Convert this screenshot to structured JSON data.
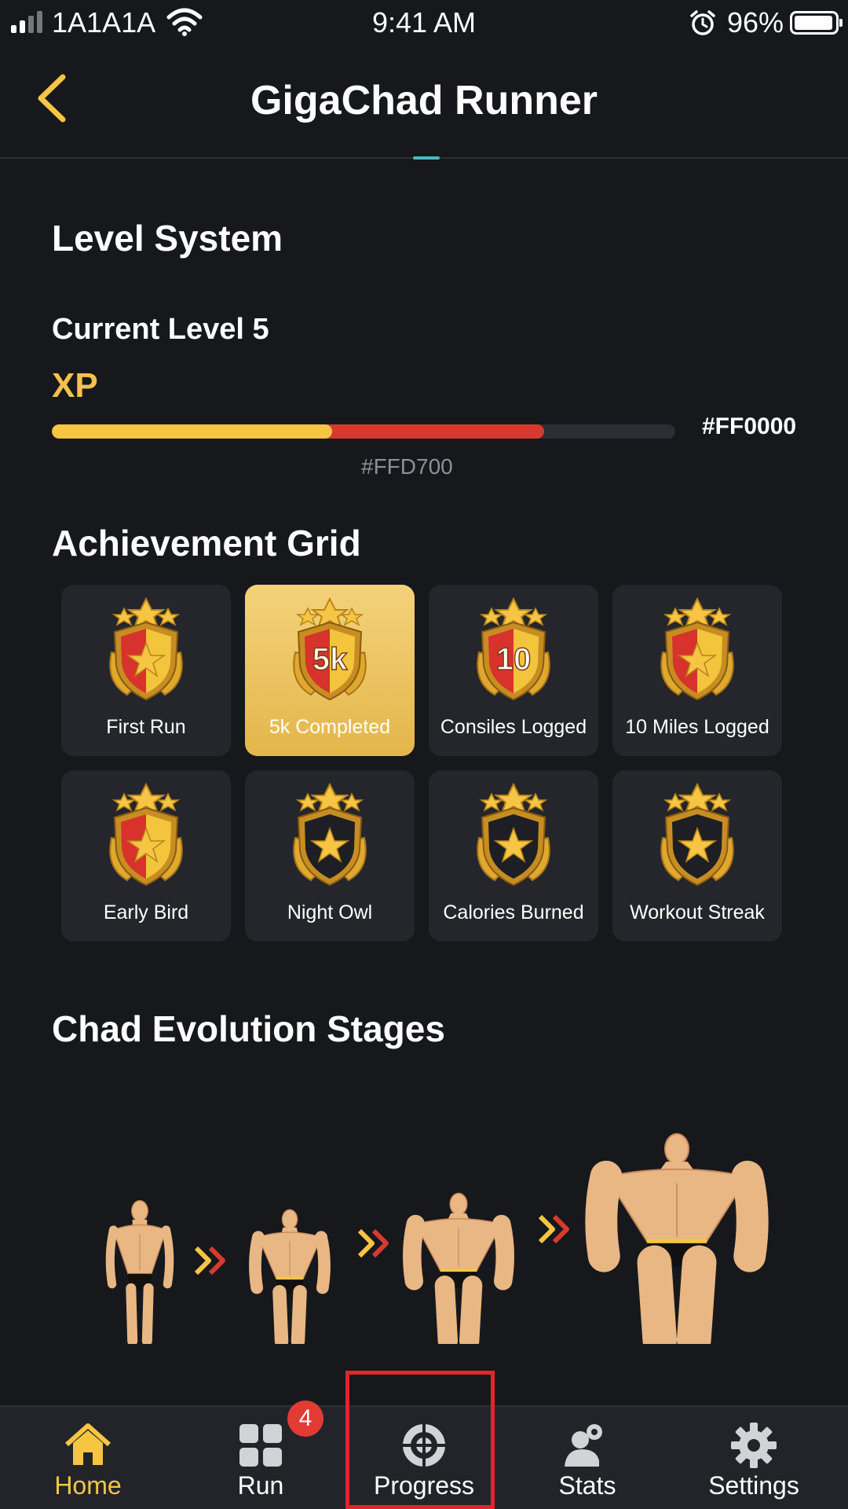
{
  "status_bar": {
    "carrier": "1A1A1A",
    "time": "9:41 AM",
    "battery": "96%",
    "battery_level": 0.96,
    "icons": [
      "signal-icon",
      "wifi-icon",
      "alarm-icon",
      "battery-icon"
    ]
  },
  "header": {
    "title": "GigaChad Runner",
    "back_icon": "chevron-left-icon"
  },
  "level_system": {
    "section_title": "Level System",
    "current_level": "Current Level 5",
    "xp_label": "XP",
    "xp_progress_gold": 0.45,
    "xp_progress_red": 0.79,
    "red_hex": "#FF0000",
    "gold_hex": "#FFD700"
  },
  "achievements": {
    "section_title": "Achievement Grid",
    "items": [
      {
        "label": "First Run",
        "unlocked": true,
        "badge_text": "",
        "highlight": false
      },
      {
        "label": "5k Completed",
        "unlocked": true,
        "badge_text": "5k",
        "highlight": true
      },
      {
        "label": "Consiles Logged",
        "unlocked": true,
        "badge_text": "10",
        "highlight": false
      },
      {
        "label": "10 Miles Logged",
        "unlocked": true,
        "badge_text": "",
        "highlight": false
      },
      {
        "label": "Early Bird",
        "unlocked": true,
        "badge_text": "",
        "highlight": false
      },
      {
        "label": "Night Owl",
        "unlocked": false,
        "badge_text": "",
        "highlight": false
      },
      {
        "label": "Calories Burned",
        "unlocked": false,
        "badge_text": "",
        "highlight": false
      },
      {
        "label": "Workout Streak",
        "unlocked": false,
        "badge_text": "",
        "highlight": false
      }
    ]
  },
  "evolution": {
    "section_title": "Chad Evolution Stages",
    "stages": 4
  },
  "bottom_nav": {
    "items": [
      {
        "label": "Home",
        "icon": "home-icon",
        "active": true
      },
      {
        "label": "Run",
        "icon": "grid-icon",
        "active": false
      },
      {
        "label": "Progress",
        "icon": "target-icon",
        "active": false
      },
      {
        "label": "Stats",
        "icon": "profile-icon",
        "active": false
      },
      {
        "label": "Settings",
        "icon": "gear-icon",
        "active": false
      }
    ],
    "run_badge": "4"
  },
  "colors": {
    "background": "#17181c",
    "accent_gold": "#f5c543",
    "accent_red": "#d63a2f",
    "card": "#24262b",
    "highlight_border": "#e0262a"
  }
}
